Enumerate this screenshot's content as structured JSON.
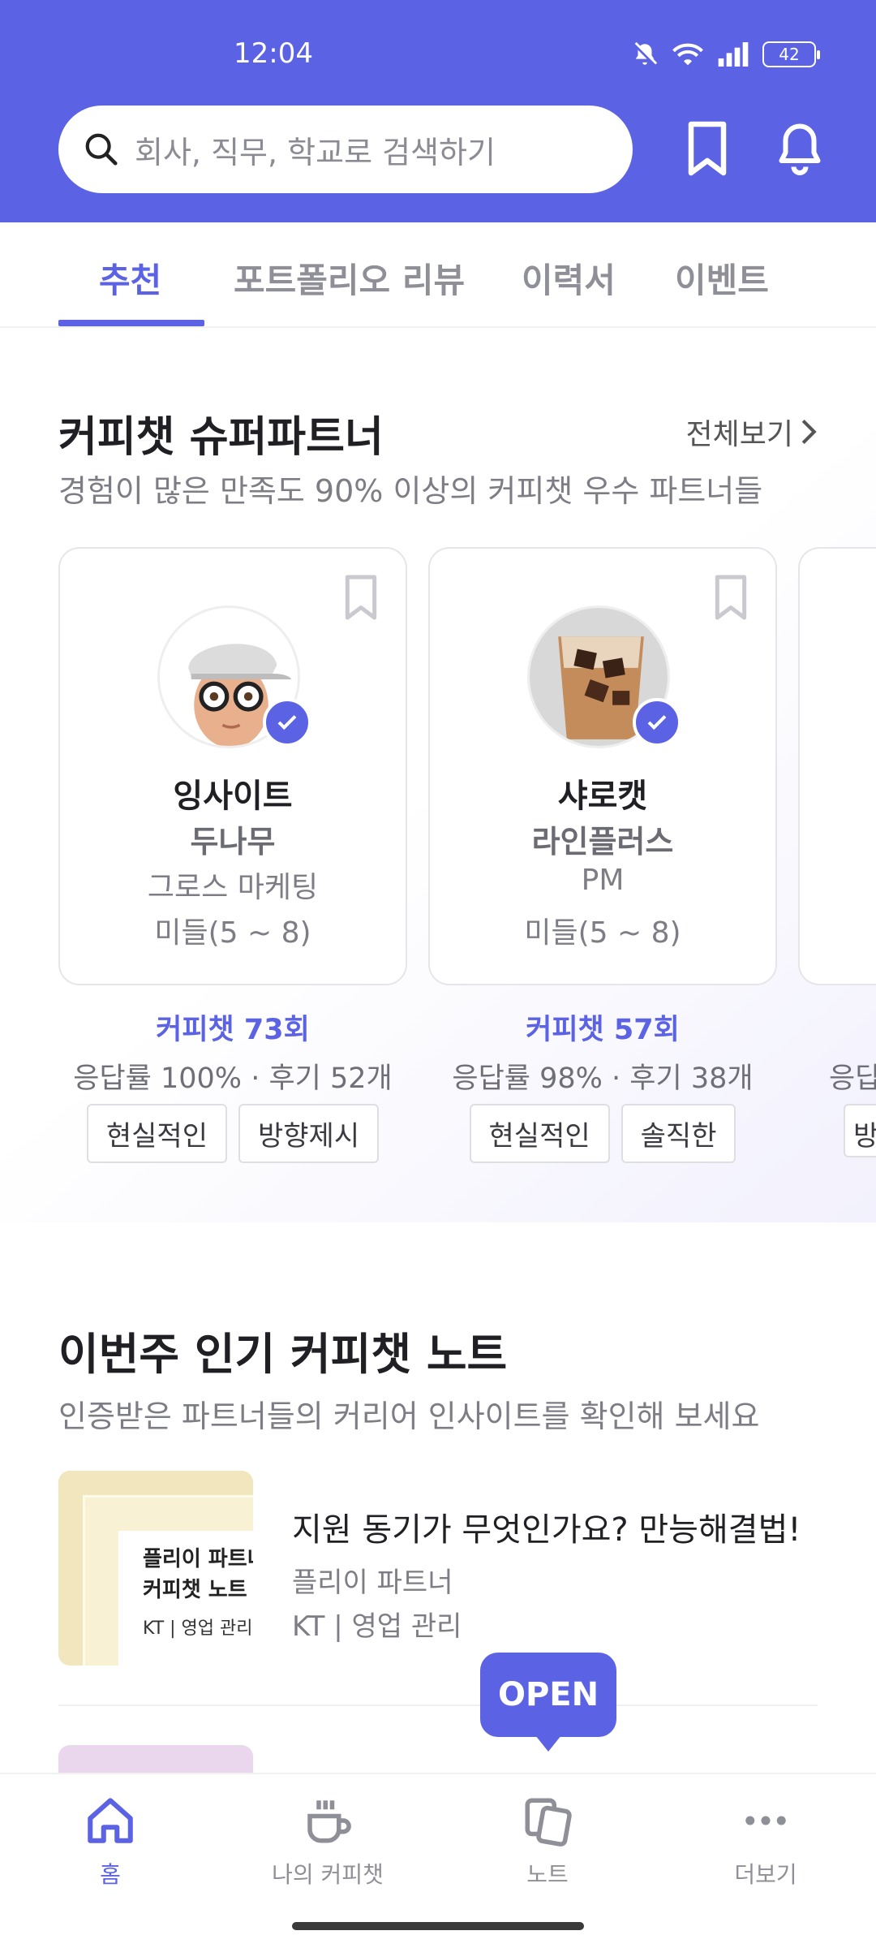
{
  "status": {
    "time": "12:04",
    "battery": "42"
  },
  "search": {
    "placeholder": "회사, 직무, 학교로 검색하기"
  },
  "tabs": [
    {
      "label": "추천"
    },
    {
      "label": "포트폴리오 리뷰"
    },
    {
      "label": "이력서"
    },
    {
      "label": "이벤트"
    }
  ],
  "super_partners": {
    "title": "커피챗 슈퍼파트너",
    "subtitle": "경험이 많은 만족도 90% 이상의 커피챗 우수 파트너들",
    "view_all": "전체보기",
    "cards": [
      {
        "name": "잉사이트",
        "company": "두나무",
        "role": "그로스 마케팅",
        "level": "미들(5 ~ 8)",
        "coffeechat": "커피챗 73회",
        "rate": "응답률 100% · 후기 52개",
        "tags": [
          "현실적인",
          "방향제시"
        ]
      },
      {
        "name": "샤로캣",
        "company": "라인플러스",
        "role": "PM",
        "level": "미들(5 ~ 8)",
        "coffeechat": "커피챗 57회",
        "rate": "응답률 98% · 후기 38개",
        "tags": [
          "현실적인",
          "솔직한"
        ]
      },
      {
        "rate_partial": "응답",
        "tag_partial": "방"
      }
    ]
  },
  "notes": {
    "title": "이번주 인기 커피챗 노트",
    "subtitle": "인증받은 파트너들의 커리어 인사이트를 확인해 보세요",
    "items": [
      {
        "thumb_line1": "플리이 파트너",
        "thumb_line2": "커피챗 노트",
        "thumb_small": "KT | 영업 관리",
        "title": "지원 동기가 무엇인가요? 만능해결법!",
        "author": "플리이 파트너",
        "meta": "KT | 영업 관리"
      }
    ]
  },
  "open_button": "OPEN",
  "bottom_nav": [
    {
      "label": "홈",
      "icon": "home-icon"
    },
    {
      "label": "나의 커피챗",
      "icon": "coffee-cup-icon"
    },
    {
      "label": "노트",
      "icon": "note-icon"
    },
    {
      "label": "더보기",
      "icon": "more-icon"
    }
  ],
  "colors": {
    "brand": "#5b63e4",
    "header_bg": "#5b63e4"
  }
}
